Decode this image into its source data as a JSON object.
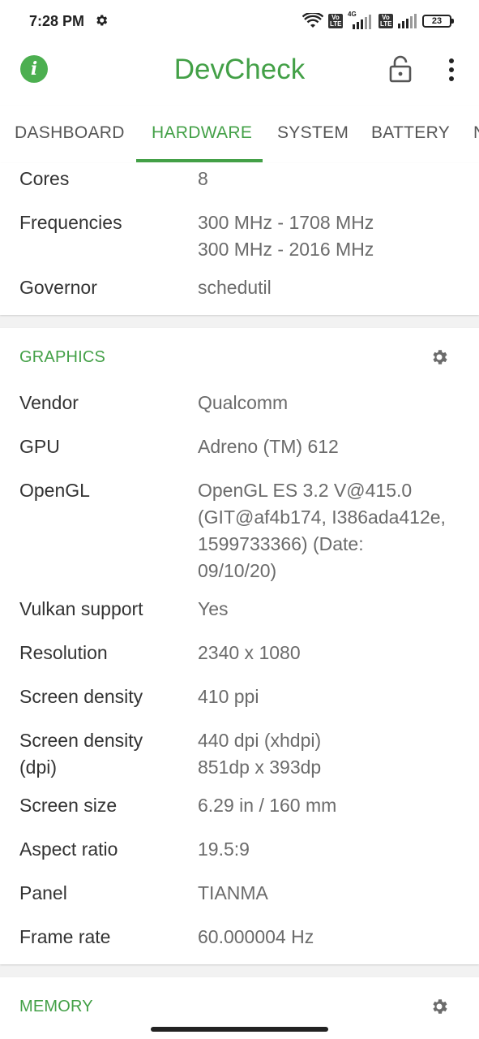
{
  "status_bar": {
    "time": "7:28 PM",
    "network_label": "4G",
    "volte_1": "Vo LTE",
    "volte_2": "Vo LTE",
    "battery": "23"
  },
  "app_bar": {
    "title": "DevCheck",
    "icons": [
      "info-icon",
      "lock-icon",
      "more-vert-icon"
    ]
  },
  "tabs": [
    {
      "label": "DASHBOARD",
      "active": false
    },
    {
      "label": "HARDWARE",
      "active": true
    },
    {
      "label": "SYSTEM",
      "active": false
    },
    {
      "label": "BATTERY",
      "active": false
    },
    {
      "label": "N",
      "active": false
    }
  ],
  "cpu": {
    "rows": [
      {
        "label": "Cores",
        "value": "8"
      },
      {
        "label": "Frequencies",
        "value_lines": [
          "300 MHz - 1708 MHz",
          "300 MHz - 2016 MHz"
        ]
      },
      {
        "label": "Governor",
        "value": "schedutil"
      }
    ]
  },
  "graphics": {
    "title": "GRAPHICS",
    "rows": [
      {
        "label": "Vendor",
        "value": "Qualcomm"
      },
      {
        "label": "GPU",
        "value": "Adreno (TM) 612"
      },
      {
        "label": "OpenGL",
        "value_lines": [
          "OpenGL ES 3.2 V@415.0",
          "(GIT@af4b174, I386ada412e,",
          "1599733366) (Date:",
          "09/10/20)"
        ]
      },
      {
        "label": "Vulkan support",
        "value": "Yes"
      },
      {
        "label": "Resolution",
        "value": "2340 x 1080"
      },
      {
        "label": "Screen density",
        "value": "410 ppi"
      },
      {
        "label_lines": [
          "Screen density",
          "(dpi)"
        ],
        "value_lines": [
          "440 dpi (xhdpi)",
          "851dp x 393dp"
        ]
      },
      {
        "label": "Screen size",
        "value": "6.29 in / 160 mm"
      },
      {
        "label": "Aspect ratio",
        "value": "19.5:9"
      },
      {
        "label": "Panel",
        "value": "TIANMA"
      },
      {
        "label": "Frame rate",
        "value": "60.000004 Hz"
      }
    ]
  },
  "memory": {
    "title": "MEMORY"
  }
}
